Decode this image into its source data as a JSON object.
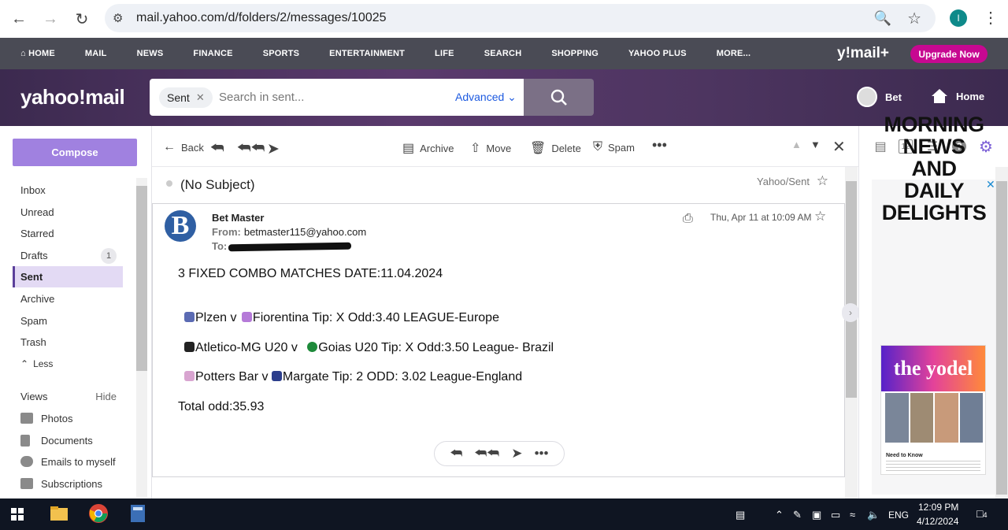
{
  "browser": {
    "url": "mail.yahoo.com/d/folders/2/messages/10025",
    "profile_initial": "I"
  },
  "topnav": {
    "items": [
      "HOME",
      "MAIL",
      "NEWS",
      "FINANCE",
      "SPORTS",
      "ENTERTAINMENT",
      "LIFE",
      "SEARCH",
      "SHOPPING",
      "YAHOO PLUS",
      "MORE..."
    ],
    "logo": "y!mail+",
    "upgrade_label": "Upgrade Now"
  },
  "header": {
    "logo": "yahoo!mail",
    "search_chip": "Sent",
    "search_placeholder": "Search in sent...",
    "advanced_label": "Advanced",
    "user_name": "Bet",
    "home_label": "Home"
  },
  "sidebar": {
    "compose_label": "Compose",
    "folders": [
      "Inbox",
      "Unread",
      "Starred",
      "Drafts",
      "Sent",
      "Archive",
      "Spam",
      "Trash"
    ],
    "drafts_count": "1",
    "less_label": "Less",
    "views_label": "Views",
    "hide_label": "Hide",
    "views": [
      "Photos",
      "Documents",
      "Emails to myself",
      "Subscriptions"
    ]
  },
  "toolbar": {
    "back_label": "Back",
    "archive_label": "Archive",
    "move_label": "Move",
    "delete_label": "Delete",
    "spam_label": "Spam"
  },
  "message": {
    "subject": "(No Subject)",
    "folder_tag": "Yahoo/Sent",
    "sender_initial": "B",
    "sender_name": "Bet Master",
    "from_label": "From:",
    "from_email": "betmaster115@yahoo.com",
    "to_label": "To:",
    "date": "Thu, Apr 11 at 10:09 AM",
    "body": {
      "heading": "3 FIXED COMBO MATCHES DATE:11.04.2024",
      "lines": [
        {
          "home": "Plzen v ",
          "away": "Fiorentina Tip: X Odd:3.40 LEAGUE-Europe"
        },
        {
          "home": "Atletico-MG U20 v ",
          "away": "Goias U20 Tip: X Odd:3.50 League- Brazil"
        },
        {
          "home": "Potters Bar v ",
          "away": "Margate Tip: 2 ODD: 3.02 League-England"
        }
      ],
      "total": "Total odd:35.93"
    }
  },
  "ad": {
    "headline": "MORNING NEWS AND DAILY DELIGHTS",
    "brand": "the yodel",
    "caption": "Need to Know"
  },
  "taskbar": {
    "lang": "ENG",
    "time": "12:09 PM",
    "date": "4/12/2024",
    "notif_count": "4"
  },
  "colors": {
    "yahoo_nav": "#4a4b55",
    "compose": "#a081e0",
    "upgrade": "#c70891",
    "active_folder": "#e3daf4"
  }
}
